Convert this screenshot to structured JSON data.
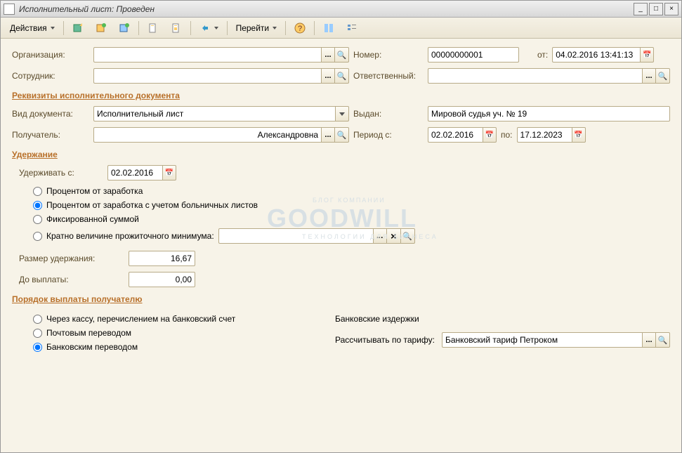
{
  "title": "Исполнительный лист: Проведен",
  "toolbar": {
    "actions": "Действия",
    "goto": "Перейти"
  },
  "header": {
    "org_label": "Организация:",
    "emp_label": "Сотрудник:",
    "number_label": "Номер:",
    "number_value": "00000000001",
    "date_label": "от:",
    "date_value": "04.02.2016 13:41:13",
    "responsible_label": "Ответственный:",
    "responsible_value": ""
  },
  "requisites": {
    "section_title": "Реквизиты исполнительного документа",
    "doctype_label": "Вид документа:",
    "doctype_value": "Исполнительный лист",
    "issued_label": "Выдан:",
    "issued_value": "Мировой судья уч. № 19",
    "recipient_label": "Получатель:",
    "recipient_value": "Александровна",
    "period_from_label": "Период с:",
    "period_from_value": "02.02.2016",
    "period_to_label": "по:",
    "period_to_value": "17.12.2023"
  },
  "withholding": {
    "section_title": "Удержание",
    "hold_from_label": "Удерживать с:",
    "hold_from_value": "02.02.2016",
    "radio_percent": "Процентом от заработка",
    "radio_percent_sick": "Процентом от заработка с учетом больничных листов",
    "radio_fixed": "Фиксированной суммой",
    "radio_minimum": "Кратно величине прожиточного минимума:",
    "amount_label": "Размер удержания:",
    "amount_value": "16,67",
    "until_label": "До выплаты:",
    "until_value": "0,00"
  },
  "payment": {
    "section_title": "Порядок выплаты получателю",
    "radio_cash": "Через кассу, перечислением на банковский счет",
    "radio_post": "Почтовым переводом",
    "radio_bank": "Банковским переводом",
    "bank_costs_label": "Банковские издержки",
    "tariff_label": "Рассчитывать по тарифу:",
    "tariff_value": "Банковский тариф Петроком"
  },
  "watermark": {
    "top": "БЛОГ КОМПАНИИ",
    "main": "GOODWILL",
    "sub": "ТЕХНОЛОГИИ ДЛЯ БИЗНЕСА"
  }
}
